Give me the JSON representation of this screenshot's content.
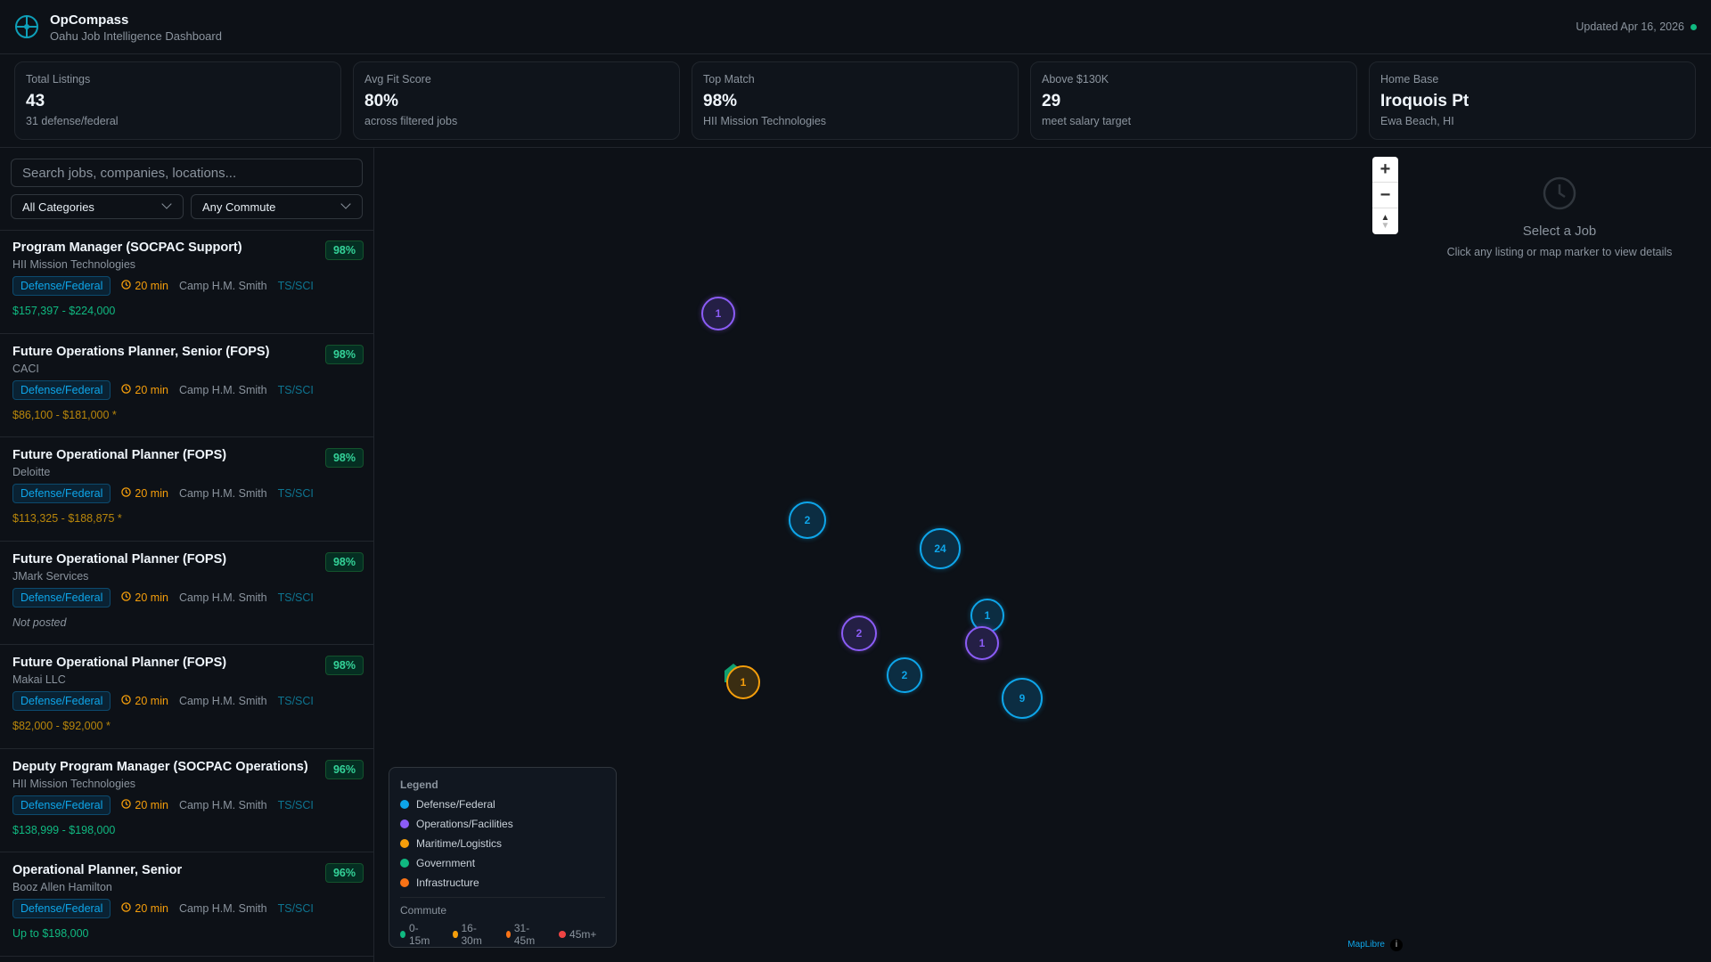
{
  "header": {
    "title": "OpCompass",
    "subtitle": "Oahu Job Intelligence Dashboard",
    "updated": "Updated Apr 16, 2026",
    "status_color": "#10b981"
  },
  "stats": [
    {
      "label": "Total Listings",
      "value": "43",
      "sub": "31 defense/federal"
    },
    {
      "label": "Avg Fit Score",
      "value": "80%",
      "sub": "across filtered jobs"
    },
    {
      "label": "Top Match",
      "value": "98%",
      "sub": "HII Mission Technologies"
    },
    {
      "label": "Above $130K",
      "value": "29",
      "sub": "meet salary target"
    },
    {
      "label": "Home Base",
      "value": "Iroquois Pt",
      "sub": "Ewa Beach, HI"
    }
  ],
  "filters": {
    "search_placeholder": "Search jobs, companies, locations...",
    "category": "All Categories",
    "commute": "Any Commute"
  },
  "jobs": [
    {
      "title": "Program Manager (SOCPAC Support)",
      "company": "HII Mission Technologies",
      "score": "98%",
      "category": "Defense/Federal",
      "commute": "20 min",
      "location": "Camp H.M. Smith",
      "clearance": "TS/SCI",
      "salary": "$157,397 - $224,000",
      "salary_style": "g"
    },
    {
      "title": "Future Operations Planner, Senior (FOPS)",
      "company": "CACI",
      "score": "98%",
      "category": "Defense/Federal",
      "commute": "20 min",
      "location": "Camp H.M. Smith",
      "clearance": "TS/SCI",
      "salary": "$86,100 - $181,000 *",
      "salary_style": "y"
    },
    {
      "title": "Future Operational Planner (FOPS)",
      "company": "Deloitte",
      "score": "98%",
      "category": "Defense/Federal",
      "commute": "20 min",
      "location": "Camp H.M. Smith",
      "clearance": "TS/SCI",
      "salary": "$113,325 - $188,875 *",
      "salary_style": "y"
    },
    {
      "title": "Future Operational Planner (FOPS)",
      "company": "JMark Services",
      "score": "98%",
      "category": "Defense/Federal",
      "commute": "20 min",
      "location": "Camp H.M. Smith",
      "clearance": "TS/SCI",
      "salary": "Not posted",
      "salary_style": "n"
    },
    {
      "title": "Future Operational Planner (FOPS)",
      "company": "Makai LLC",
      "score": "98%",
      "category": "Defense/Federal",
      "commute": "20 min",
      "location": "Camp H.M. Smith",
      "clearance": "TS/SCI",
      "salary": "$82,000 - $92,000 *",
      "salary_style": "y"
    },
    {
      "title": "Deputy Program Manager (SOCPAC Operations)",
      "company": "HII Mission Technologies",
      "score": "96%",
      "category": "Defense/Federal",
      "commute": "20 min",
      "location": "Camp H.M. Smith",
      "clearance": "TS/SCI",
      "salary": "$138,999 - $198,000",
      "salary_style": "g"
    },
    {
      "title": "Operational Planner, Senior",
      "company": "Booz Allen Hamilton",
      "score": "96%",
      "category": "Defense/Federal",
      "commute": "20 min",
      "location": "Camp H.M. Smith",
      "clearance": "TS/SCI",
      "salary": "Up to $198,000",
      "salary_style": "g"
    }
  ],
  "map": {
    "markers": [
      {
        "count": "1",
        "category": "Operations/Facilities"
      },
      {
        "count": "2",
        "category": "Defense/Federal"
      },
      {
        "count": "24",
        "category": "Defense/Federal"
      },
      {
        "count": "1",
        "category": "Defense/Federal"
      },
      {
        "count": "2",
        "category": "Operations/Facilities"
      },
      {
        "count": "1",
        "category": "Operations/Facilities"
      },
      {
        "count": "2",
        "category": "Defense/Federal"
      },
      {
        "count": "9",
        "category": "Defense/Federal"
      },
      {
        "count": "1",
        "category": "Maritime/Logistics"
      }
    ],
    "attribution": "MapLibre"
  },
  "legend": {
    "title": "Legend",
    "categories": [
      {
        "label": "Defense/Federal",
        "color": "#0ea5e9"
      },
      {
        "label": "Operations/Facilities",
        "color": "#8b5cf6"
      },
      {
        "label": "Maritime/Logistics",
        "color": "#f59e0b"
      },
      {
        "label": "Government",
        "color": "#10b981"
      },
      {
        "label": "Infrastructure",
        "color": "#f97316"
      }
    ],
    "commute_title": "Commute",
    "commute": [
      {
        "label": "0-15m",
        "color": "#10b981"
      },
      {
        "label": "16-30m",
        "color": "#f59e0b"
      },
      {
        "label": "31-45m",
        "color": "#f97316"
      },
      {
        "label": "45m+",
        "color": "#ef4444"
      }
    ]
  },
  "detail": {
    "title": "Select a Job",
    "hint": "Click any listing or map marker to view details"
  }
}
